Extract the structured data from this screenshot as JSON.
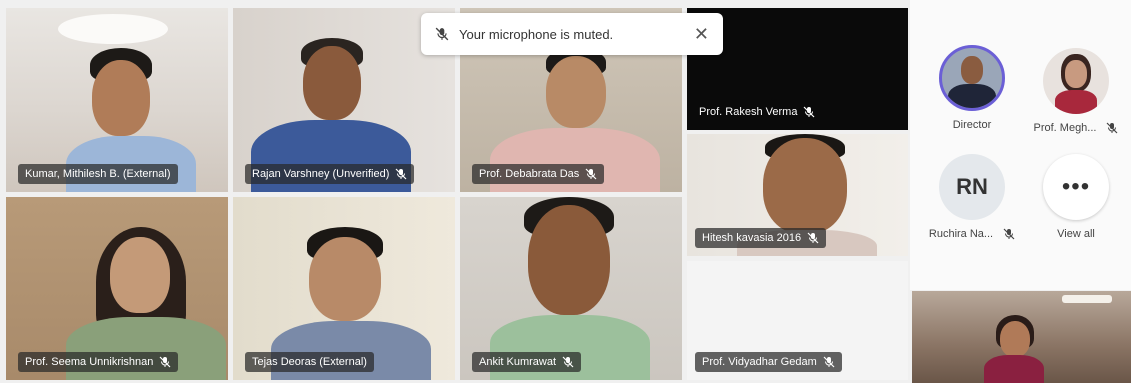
{
  "toast": {
    "message": "Your microphone is muted.",
    "close_glyph": "✕"
  },
  "tiles": [
    {
      "name": "Kumar, Mithilesh B. (External)",
      "muted": false
    },
    {
      "name": "Rajan Varshney (Unverified)",
      "muted": true
    },
    {
      "name": "Prof. Debabrata Das",
      "muted": true
    },
    {
      "name": "Prof. Rakesh Verma",
      "muted": true
    },
    {
      "name": "Hitesh kavasia 2016",
      "muted": true
    },
    {
      "name": "Prof. Seema Unnikrishnan",
      "muted": true
    },
    {
      "name": "Tejas Deoras (External)",
      "muted": false
    },
    {
      "name": "Ankit Kumrawat",
      "muted": true
    },
    {
      "name": "Prof. Vidyadhar Gedam",
      "muted": true
    }
  ],
  "sidebar": {
    "participants": [
      {
        "label": "Director",
        "muted": false
      },
      {
        "label": "Prof. Megh...",
        "muted": true
      },
      {
        "label": "Ruchira Na...",
        "initials": "RN",
        "muted": true
      }
    ],
    "view_all": {
      "label": "View all",
      "glyph": "•••"
    }
  },
  "colors": {
    "name_tag_bg": "#282828",
    "active_speaker_ring": "#6b5fd6",
    "toast_bg": "#ffffff"
  }
}
